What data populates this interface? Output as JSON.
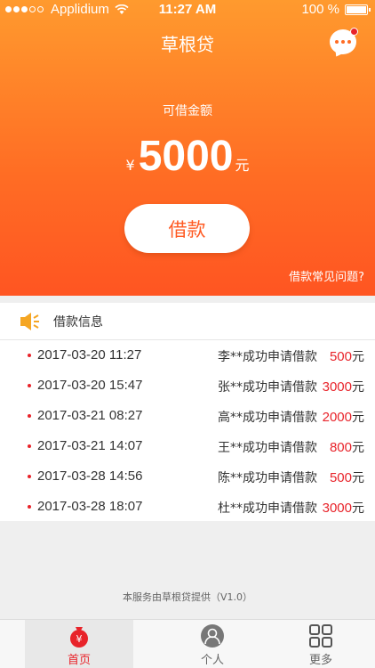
{
  "status_bar": {
    "carrier": "Applidium",
    "time": "11:27 AM",
    "battery": "100 %"
  },
  "header": {
    "title": "草根贷"
  },
  "loan": {
    "available_label": "可借金额",
    "currency": "¥",
    "amount": "5000",
    "unit": "元",
    "borrow_button": "借款",
    "faq_link": "借款常见问题?"
  },
  "info": {
    "title": "借款信息",
    "rows": [
      {
        "date": "2017-03-20  11:27",
        "desc": "李**成功申请借款",
        "amount": "500",
        "unit": "元"
      },
      {
        "date": "2017-03-20  15:47",
        "desc": "张**成功申请借款",
        "amount": "3000",
        "unit": "元"
      },
      {
        "date": "2017-03-21  08:27",
        "desc": "高**成功申请借款",
        "amount": "2000",
        "unit": "元"
      },
      {
        "date": "2017-03-21  14:07",
        "desc": "王**成功申请借款",
        "amount": "800",
        "unit": "元"
      },
      {
        "date": "2017-03-28  14:56",
        "desc": "陈**成功申请借款",
        "amount": "500",
        "unit": "元"
      },
      {
        "date": "2017-03-28  18:07",
        "desc": "杜**成功申请借款",
        "amount": "3000",
        "unit": "元"
      }
    ]
  },
  "footer_note": "本服务由草根贷提供（V1.0）",
  "tabs": [
    {
      "label": "首页",
      "icon": "money-bag-icon",
      "active": true
    },
    {
      "label": "个人",
      "icon": "person-icon",
      "active": false
    },
    {
      "label": "更多",
      "icon": "grid-icon",
      "active": false
    }
  ],
  "colors": {
    "accent": "#ff6c24",
    "alert_red": "#e8232a"
  }
}
